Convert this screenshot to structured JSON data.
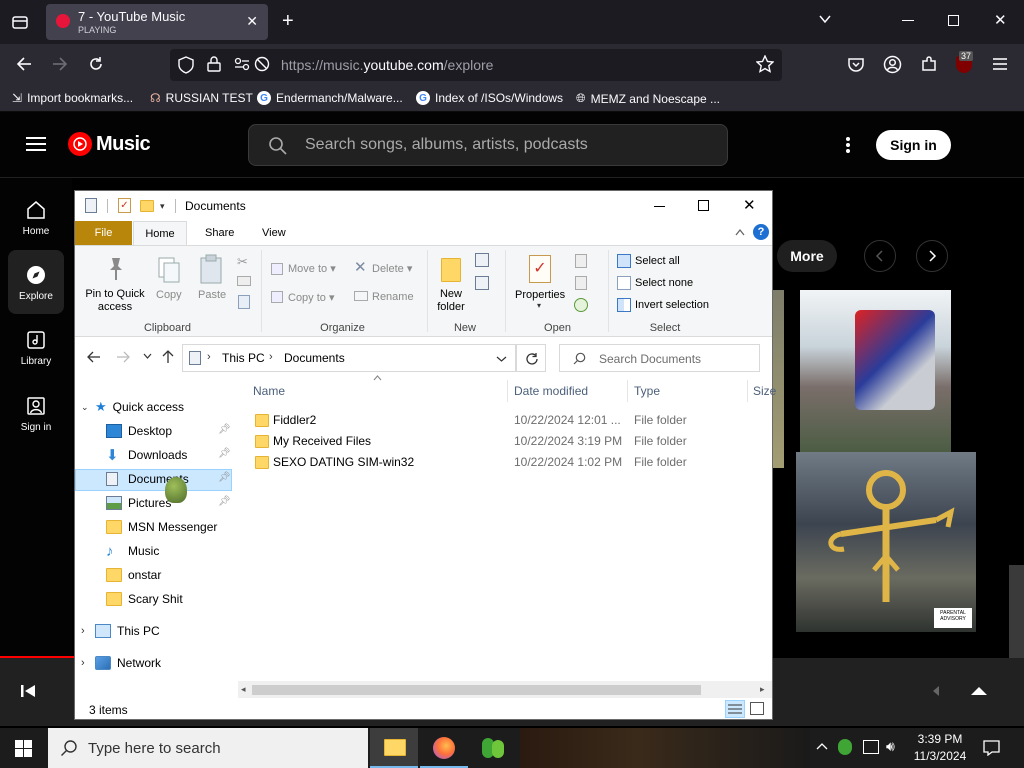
{
  "browser": {
    "tab_title": "7 - YouTube Music",
    "tab_status": "PLAYING",
    "url_prefix": "https://music.",
    "url_domain": "youtube.com",
    "url_path": "/explore",
    "notification_count": "37",
    "bookmarks": [
      "Import bookmarks...",
      "RUSSIAN TEST",
      "Endermanch/Malware...",
      "Index of /ISOs/Windows",
      "MEMZ and Noescape ..."
    ]
  },
  "ytm": {
    "logo_text": "Music",
    "search_placeholder": "Search songs, albums, artists, podcasts",
    "sign_in": "Sign in",
    "more": "More",
    "nav": [
      {
        "label": "Home"
      },
      {
        "label": "Explore"
      },
      {
        "label": "Library"
      },
      {
        "label": "Sign in"
      }
    ]
  },
  "explorer": {
    "title": "Documents",
    "tabs": [
      "File",
      "Home",
      "Share",
      "View"
    ],
    "ribbon": {
      "pin": "Pin to Quick access",
      "copy": "Copy",
      "paste": "Paste",
      "move_to": "Move to",
      "copy_to": "Copy to",
      "delete": "Delete",
      "rename": "Rename",
      "new_folder": "New folder",
      "properties": "Properties",
      "select_all": "Select all",
      "select_none": "Select none",
      "invert_selection": "Invert selection",
      "groups": [
        "Clipboard",
        "Organize",
        "New",
        "Open",
        "Select"
      ]
    },
    "breadcrumb": [
      "This PC",
      "Documents"
    ],
    "search_placeholder": "Search Documents",
    "nav_pane": {
      "quick_access": "Quick access",
      "items": [
        "Desktop",
        "Downloads",
        "Documents",
        "Pictures",
        "MSN Messenger",
        "Music",
        "onstar",
        "Scary Shit"
      ],
      "this_pc": "This PC",
      "network": "Network"
    },
    "columns": [
      "Name",
      "Date modified",
      "Type",
      "Size"
    ],
    "files": [
      {
        "name": "Fiddler2",
        "date": "10/22/2024 12:01 ...",
        "type": "File folder"
      },
      {
        "name": "My Received Files",
        "date": "10/22/2024 3:19 PM",
        "type": "File folder"
      },
      {
        "name": "SEXO DATING SIM-win32",
        "date": "10/22/2024 1:02 PM",
        "type": "File folder"
      }
    ],
    "status": "3 items"
  },
  "taskbar": {
    "search_placeholder": "Type here to search",
    "time": "3:39 PM",
    "date": "11/3/2024"
  },
  "colors": {
    "ytm_red": "#ff0000",
    "file_tab": "#b8860b",
    "selection": "#cce8ff"
  }
}
